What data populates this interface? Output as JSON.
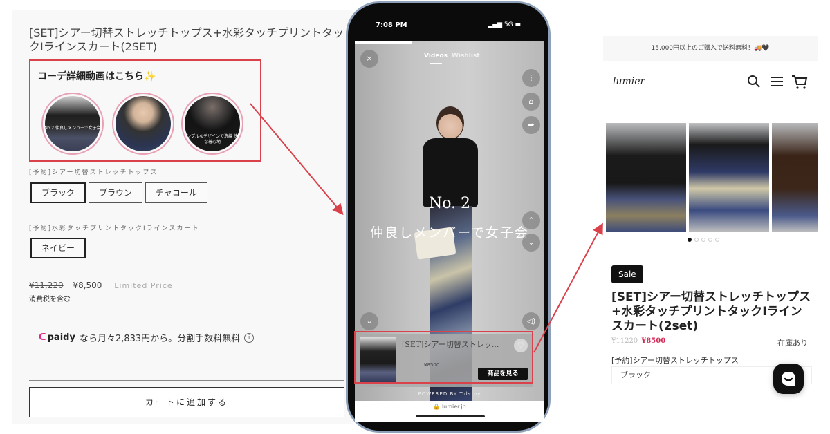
{
  "left_panel": {
    "product_title": "[SET]シアー切替ストレッチトップス+水彩タッチプリントタックIラインスカート(2SET)",
    "video_heading": "コーデ詳細動画はこちら✨",
    "video_thumbs": [
      {
        "caption": "No.2 仲良しメンバーで女子会"
      },
      {
        "caption": ""
      },
      {
        "caption": "シンプルなデザインで洗練 快適な着心地"
      }
    ],
    "option_groups": [
      {
        "label": "[予約]シアー切替ストレッチトップス",
        "options": [
          "ブラック",
          "ブラウン",
          "チャコール"
        ],
        "selected": "ブラック"
      },
      {
        "label": "[予約]水彩タッチプリントタックIラインスカート",
        "options": [
          "ネイビー"
        ],
        "selected": "ネイビー"
      }
    ],
    "price_original": "¥11,220",
    "price_sale": "¥8,500",
    "price_note": "Limited Price",
    "tax_note": "消費税を含む",
    "paidy": {
      "brand": "paidy",
      "text": "なら月々2,833円から。分割手数料無料",
      "info_icon": "i"
    },
    "add_to_cart": "カートに追加する"
  },
  "phone": {
    "status_time": "7:08 PM",
    "status_right": "5G",
    "tabs": [
      "Videos",
      "Wishlist"
    ],
    "active_tab": "Videos",
    "overlay_number": "No. 2",
    "overlay_text": "仲良しメンバーで女子会",
    "video_progress_percent": 30,
    "product_card": {
      "name": "[SET]シアー切替ストレッ...",
      "price": "¥8500",
      "button": "商品を見る"
    },
    "powered_by": "POWERED BY Tolstoy",
    "url": "lumier.jp",
    "icons": {
      "close": "×",
      "more": "⋮",
      "bag": "⌂",
      "share": "➦",
      "up": "⌃",
      "down": "⌄",
      "collapse": "⌄",
      "sound": "◁)",
      "heart": "♡",
      "lock": "🔒"
    }
  },
  "right_panel": {
    "shipping_banner": "15,000円以上のご購入で送料無料！🚚🖤",
    "logo": "lumier",
    "gallery_dots": 5,
    "gallery_active_index": 0,
    "badge": "Sale",
    "product_title": "[SET]シアー切替ストレッチトップス+水彩タッチプリントタックIラインスカート(2set)",
    "price_original": "¥11220",
    "price_sale": "¥8500",
    "stock": "在庫あり",
    "option_label": "[予約]シアー切替ストレッチトップス",
    "option_value": "ブラック",
    "icons": {
      "search": "⚲",
      "menu": "☰",
      "cart": "🛒",
      "chat": "◡"
    }
  },
  "colors": {
    "highlight_red": "#d9414b",
    "sale_red": "#d22a55",
    "paidy_pink": "#e0288c"
  }
}
